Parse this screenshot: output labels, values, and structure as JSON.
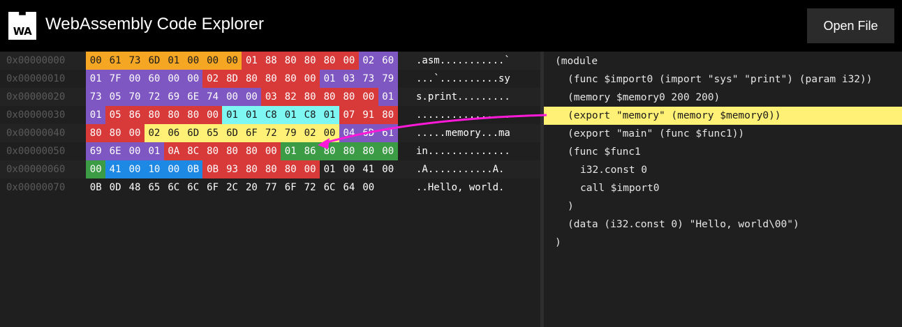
{
  "app": {
    "title": "WebAssembly Code Explorer",
    "logo_text": "WA"
  },
  "toolbar": {
    "open_file_label": "Open File"
  },
  "hex": {
    "rows": [
      {
        "offset": "0x00000000",
        "ascii": ".asm...........`",
        "bytes": [
          [
            "00",
            "orange"
          ],
          [
            "61",
            "orange"
          ],
          [
            "73",
            "orange"
          ],
          [
            "6D",
            "orange"
          ],
          [
            "01",
            "orange"
          ],
          [
            "00",
            "orange"
          ],
          [
            "00",
            "orange"
          ],
          [
            "00",
            "orange"
          ],
          [
            "01",
            "red"
          ],
          [
            "88",
            "red"
          ],
          [
            "80",
            "red"
          ],
          [
            "80",
            "red"
          ],
          [
            "80",
            "red"
          ],
          [
            "00",
            "red"
          ],
          [
            "02",
            "purple"
          ],
          [
            "60",
            "purple"
          ]
        ]
      },
      {
        "offset": "0x00000010",
        "ascii": "...`..........sy",
        "bytes": [
          [
            "01",
            "purple"
          ],
          [
            "7F",
            "purple"
          ],
          [
            "00",
            "purple"
          ],
          [
            "60",
            "purple"
          ],
          [
            "00",
            "purple"
          ],
          [
            "00",
            "purple"
          ],
          [
            "02",
            "red"
          ],
          [
            "8D",
            "red"
          ],
          [
            "80",
            "red"
          ],
          [
            "80",
            "red"
          ],
          [
            "80",
            "red"
          ],
          [
            "00",
            "red"
          ],
          [
            "01",
            "purple"
          ],
          [
            "03",
            "purple"
          ],
          [
            "73",
            "purple"
          ],
          [
            "79",
            "purple"
          ]
        ]
      },
      {
        "offset": "0x00000020",
        "ascii": "s.print.........",
        "bytes": [
          [
            "73",
            "purple"
          ],
          [
            "05",
            "purple"
          ],
          [
            "70",
            "purple"
          ],
          [
            "72",
            "purple"
          ],
          [
            "69",
            "purple"
          ],
          [
            "6E",
            "purple"
          ],
          [
            "74",
            "purple"
          ],
          [
            "00",
            "purple"
          ],
          [
            "00",
            "purple"
          ],
          [
            "03",
            "red"
          ],
          [
            "82",
            "red"
          ],
          [
            "80",
            "red"
          ],
          [
            "80",
            "red"
          ],
          [
            "80",
            "red"
          ],
          [
            "00",
            "red"
          ],
          [
            "01",
            "purple"
          ]
        ]
      },
      {
        "offset": "0x00000030",
        "ascii": "................",
        "bytes": [
          [
            "01",
            "purple"
          ],
          [
            "05",
            "red"
          ],
          [
            "86",
            "red"
          ],
          [
            "80",
            "red"
          ],
          [
            "80",
            "red"
          ],
          [
            "80",
            "red"
          ],
          [
            "00",
            "red"
          ],
          [
            "01",
            "cyan"
          ],
          [
            "01",
            "cyan"
          ],
          [
            "C8",
            "cyan"
          ],
          [
            "01",
            "cyan"
          ],
          [
            "C8",
            "cyan"
          ],
          [
            "01",
            "cyan"
          ],
          [
            "07",
            "red"
          ],
          [
            "91",
            "red"
          ],
          [
            "80",
            "red"
          ]
        ]
      },
      {
        "offset": "0x00000040",
        "ascii": ".....memory...ma",
        "bytes": [
          [
            "80",
            "red"
          ],
          [
            "80",
            "red"
          ],
          [
            "00",
            "red"
          ],
          [
            "02",
            "yellow"
          ],
          [
            "06",
            "yellow"
          ],
          [
            "6D",
            "yellow"
          ],
          [
            "65",
            "yellow"
          ],
          [
            "6D",
            "yellow"
          ],
          [
            "6F",
            "yellow"
          ],
          [
            "72",
            "yellow"
          ],
          [
            "79",
            "yellow"
          ],
          [
            "02",
            "yellow"
          ],
          [
            "00",
            "yellow"
          ],
          [
            "04",
            "purple"
          ],
          [
            "6D",
            "purple"
          ],
          [
            "61",
            "purple"
          ]
        ]
      },
      {
        "offset": "0x00000050",
        "ascii": "in..............",
        "bytes": [
          [
            "69",
            "purple"
          ],
          [
            "6E",
            "purple"
          ],
          [
            "00",
            "purple"
          ],
          [
            "01",
            "purple"
          ],
          [
            "0A",
            "red"
          ],
          [
            "8C",
            "red"
          ],
          [
            "80",
            "red"
          ],
          [
            "80",
            "red"
          ],
          [
            "80",
            "red"
          ],
          [
            "00",
            "red"
          ],
          [
            "01",
            "green"
          ],
          [
            "86",
            "green"
          ],
          [
            "80",
            "green"
          ],
          [
            "80",
            "green"
          ],
          [
            "80",
            "green"
          ],
          [
            "00",
            "green"
          ]
        ]
      },
      {
        "offset": "0x00000060",
        "ascii": ".A...........A.",
        "bytes": [
          [
            "00",
            "green"
          ],
          [
            "41",
            "blue"
          ],
          [
            "00",
            "blue"
          ],
          [
            "10",
            "blue"
          ],
          [
            "00",
            "blue"
          ],
          [
            "0B",
            "blue"
          ],
          [
            "0B",
            "red"
          ],
          [
            "93",
            "red"
          ],
          [
            "80",
            "red"
          ],
          [
            "80",
            "red"
          ],
          [
            "80",
            "red"
          ],
          [
            "00",
            "red"
          ],
          [
            "01",
            "none"
          ],
          [
            "00",
            "none"
          ],
          [
            "41",
            "none"
          ],
          [
            "00",
            "none"
          ]
        ]
      },
      {
        "offset": "0x00000070",
        "ascii": "..Hello, world.",
        "bytes": [
          [
            "0B",
            "none"
          ],
          [
            "0D",
            "none"
          ],
          [
            "48",
            "none"
          ],
          [
            "65",
            "none"
          ],
          [
            "6C",
            "none"
          ],
          [
            "6C",
            "none"
          ],
          [
            "6F",
            "none"
          ],
          [
            "2C",
            "none"
          ],
          [
            "20",
            "none"
          ],
          [
            "77",
            "none"
          ],
          [
            "6F",
            "none"
          ],
          [
            "72",
            "none"
          ],
          [
            "6C",
            "none"
          ],
          [
            "64",
            "none"
          ],
          [
            "00",
            "none"
          ]
        ]
      }
    ]
  },
  "code": {
    "lines": [
      {
        "text": "(module",
        "indent": 0,
        "highlight": false
      },
      {
        "text": "(func $import0 (import \"sys\" \"print\") (param i32))",
        "indent": 1,
        "highlight": false
      },
      {
        "text": "(memory $memory0 200 200)",
        "indent": 1,
        "highlight": false
      },
      {
        "text": "(export \"memory\" (memory $memory0))",
        "indent": 1,
        "highlight": true
      },
      {
        "text": "(export \"main\" (func $func1))",
        "indent": 1,
        "highlight": false
      },
      {
        "text": "(func $func1",
        "indent": 1,
        "highlight": false
      },
      {
        "text": "i32.const 0",
        "indent": 2,
        "highlight": false
      },
      {
        "text": "call $import0",
        "indent": 2,
        "highlight": false
      },
      {
        "text": ")",
        "indent": 1,
        "highlight": false
      },
      {
        "text": "(data (i32.const 0) \"Hello, world\\00\")",
        "indent": 1,
        "highlight": false
      },
      {
        "text": ")",
        "indent": 0,
        "highlight": false
      }
    ]
  },
  "colors": {
    "orange": "#f5a623",
    "red": "#d83a3a",
    "purple": "#7e57c2",
    "cyan": "#7ef7f2",
    "yellow": "#fff176",
    "blue": "#1e88e5",
    "green": "#3c9b45",
    "arrow": "#ff19d9"
  }
}
